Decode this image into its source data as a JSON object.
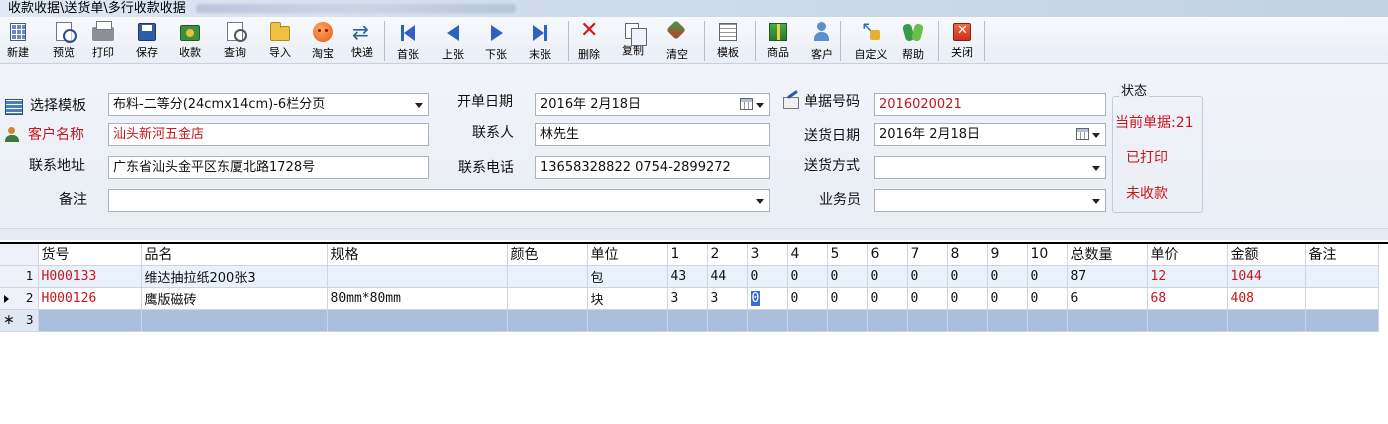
{
  "window": {
    "title": "收款收据\\送货单\\多行收款收据"
  },
  "toolbar": [
    {
      "id": "new",
      "label": "新建",
      "icon": "grid-icon",
      "cls": "i-grid"
    },
    {
      "id": "preview",
      "label": "预览",
      "icon": "preview-icon",
      "cls": "i-doc"
    },
    {
      "id": "print",
      "label": "打印",
      "icon": "printer-icon",
      "cls": "i-print"
    },
    {
      "id": "save",
      "label": "保存",
      "icon": "floppy-icon",
      "cls": "i-save"
    },
    {
      "id": "receipt",
      "label": "收款",
      "icon": "cash-icon",
      "cls": "i-cash"
    },
    {
      "id": "query",
      "label": "查询",
      "icon": "magnifier-icon",
      "cls": "i-query"
    },
    {
      "id": "import",
      "label": "导入",
      "icon": "folder-icon",
      "cls": "i-folder"
    },
    {
      "id": "taobao",
      "label": "淘宝",
      "icon": "taobao-icon",
      "cls": "i-taobao"
    },
    {
      "id": "express",
      "label": "快递",
      "icon": "express-icon",
      "cls": "i-express"
    },
    {
      "id": "first",
      "label": "首张",
      "icon": "first-record-icon",
      "cls": "i-first"
    },
    {
      "id": "prev",
      "label": "上张",
      "icon": "previous-record-icon",
      "cls": "i-prev"
    },
    {
      "id": "next",
      "label": "下张",
      "icon": "next-record-icon",
      "cls": "i-next"
    },
    {
      "id": "last",
      "label": "末张",
      "icon": "last-record-icon",
      "cls": "i-last"
    },
    {
      "id": "delete",
      "label": "删除",
      "icon": "delete-icon",
      "cls": "i-delete"
    },
    {
      "id": "copy",
      "label": "复制",
      "icon": "copy-icon",
      "cls": "i-copy"
    },
    {
      "id": "clear",
      "label": "清空",
      "icon": "clear-icon",
      "cls": "i-clear"
    },
    {
      "id": "template",
      "label": "模板",
      "icon": "template-icon",
      "cls": "i-template"
    },
    {
      "id": "goods",
      "label": "商品",
      "icon": "goods-icon",
      "cls": "i-goods"
    },
    {
      "id": "customer",
      "label": "客户",
      "icon": "customer-icon",
      "cls": "i-customer"
    },
    {
      "id": "custom",
      "label": "自定义",
      "icon": "customize-icon",
      "cls": "i-custom"
    },
    {
      "id": "help",
      "label": "帮助",
      "icon": "help-icon",
      "cls": "i-help"
    },
    {
      "id": "close",
      "label": "关闭",
      "icon": "close-icon",
      "cls": "i-close"
    }
  ],
  "form": {
    "template_label": "选择模板",
    "template_value": "布料-二等分(24cmx14cm)-6栏分页",
    "open_date_label": "开单日期",
    "open_date_value": "2016年 2月18日",
    "doc_no_label": "单据号码",
    "doc_no_value": "2016020021",
    "customer_label": "客户名称",
    "customer_value": "汕头新河五金店",
    "contact_label": "联系人",
    "contact_value": "林先生",
    "delivery_date_label": "送货日期",
    "delivery_date_value": "2016年 2月18日",
    "address_label": "联系地址",
    "address_value": "广东省汕头金平区东厦北路1728号",
    "phone_label": "联系电话",
    "phone_value": "13658328822 0754-2899272",
    "delivery_method_label": "送货方式",
    "delivery_method_value": "",
    "remark_label": "备注",
    "remark_value": "",
    "salesperson_label": "业务员",
    "salesperson_value": ""
  },
  "status": {
    "title": "状态",
    "current": "当前单据:21",
    "printed": "已打印",
    "unpaid": "未收款"
  },
  "grid": {
    "columns": [
      "货号",
      "品名",
      "规格",
      "颜色",
      "单位",
      "1",
      "2",
      "3",
      "4",
      "5",
      "6",
      "7",
      "8",
      "9",
      "10",
      "总数量",
      "单价",
      "金额",
      "备注"
    ],
    "rows": [
      {
        "no": "1",
        "cells": [
          "H000133",
          "维达抽拉纸200张3",
          "",
          "",
          "包",
          "43",
          "44",
          "0",
          "0",
          "0",
          "0",
          "0",
          "0",
          "0",
          "0",
          "87",
          "12",
          "1044",
          ""
        ]
      },
      {
        "no": "2",
        "cells": [
          "H000126",
          "鹰版磁砖",
          "80mm*80mm",
          "",
          "块",
          "3",
          "3",
          "0",
          "0",
          "0",
          "0",
          "0",
          "0",
          "0",
          "0",
          "6",
          "68",
          "408",
          ""
        ]
      },
      {
        "no": "3",
        "cells": [
          "",
          "",
          "",
          "",
          "",
          "",
          "",
          "",
          "",
          "",
          "",
          "",
          "",
          "",
          "",
          "",
          "",
          "",
          ""
        ]
      }
    ]
  }
}
